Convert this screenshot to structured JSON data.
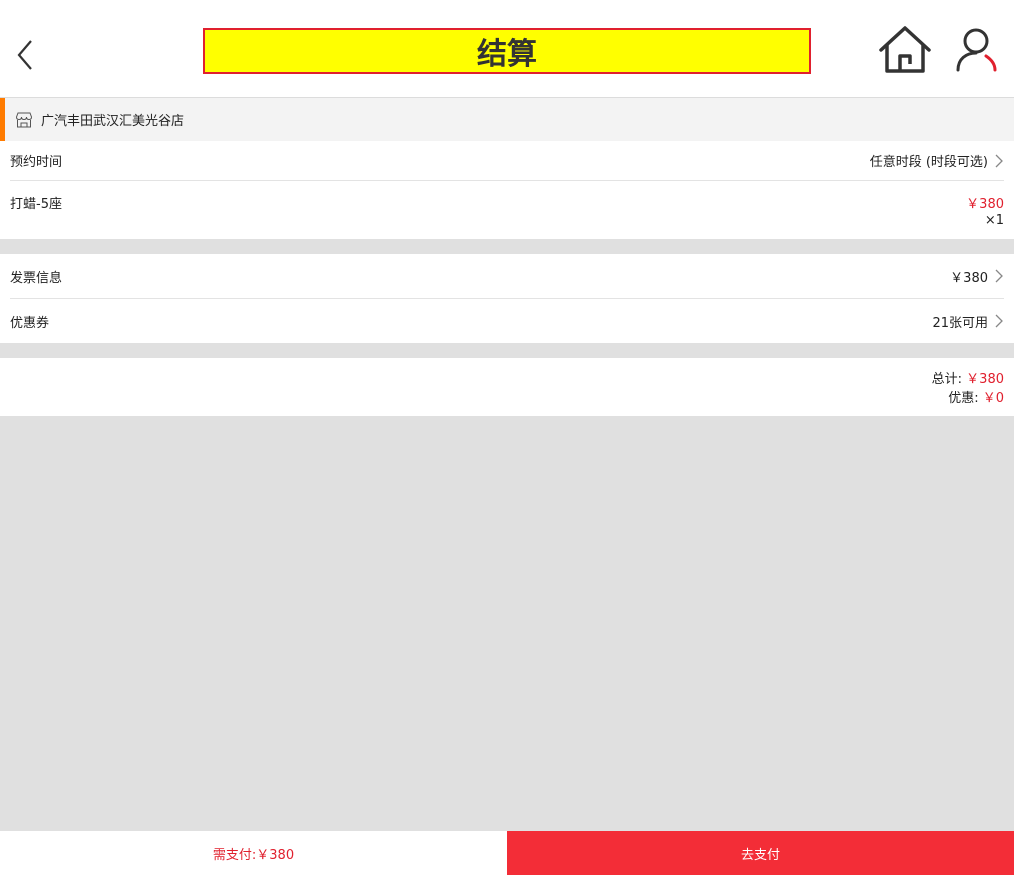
{
  "header": {
    "title": "结算"
  },
  "store": {
    "name": "广汽丰田武汉汇美光谷店"
  },
  "appointment": {
    "label": "预约时间",
    "value": "任意时段 (时段可选)"
  },
  "product": {
    "name": "打蜡-5座",
    "price": "￥380",
    "quantity": "×1"
  },
  "invoice": {
    "label": "发票信息",
    "value": "￥380"
  },
  "coupon": {
    "label": "优惠券",
    "value": "21张可用"
  },
  "summary": {
    "total_label": "总计:",
    "total_value": "￥380",
    "discount_label": "优惠:",
    "discount_value": "￥0"
  },
  "footer": {
    "amount_due": "需支付:￥380",
    "pay_button": "去支付"
  },
  "colors": {
    "accent_red": "#f32d37",
    "price_red": "#e0202e",
    "title_highlight": "#ffff00",
    "store_accent": "#ff7b00"
  },
  "icons": [
    "back-arrow-icon",
    "home-icon",
    "user-icon",
    "store-icon",
    "chevron-right-icon"
  ]
}
